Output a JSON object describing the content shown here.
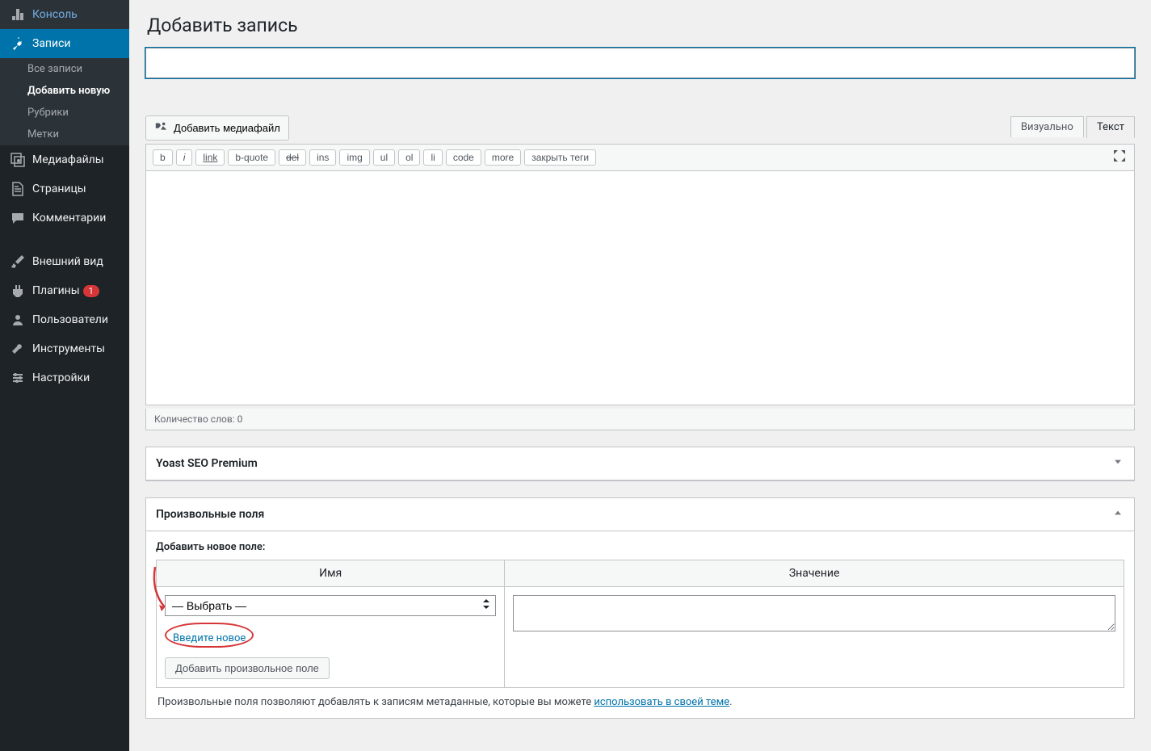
{
  "sidebar": {
    "items": [
      {
        "icon": "dashboard",
        "label": "Консоль"
      },
      {
        "icon": "pin",
        "label": "Записи",
        "active": true
      },
      {
        "icon": "media",
        "label": "Медиафайлы"
      },
      {
        "icon": "page",
        "label": "Страницы"
      },
      {
        "icon": "comment",
        "label": "Комментарии"
      },
      {
        "icon": "appearance",
        "label": "Внешний вид"
      },
      {
        "icon": "plugin",
        "label": "Плагины",
        "badge": "1"
      },
      {
        "icon": "users",
        "label": "Пользователи"
      },
      {
        "icon": "tools",
        "label": "Инструменты"
      },
      {
        "icon": "settings",
        "label": "Настройки"
      }
    ],
    "submenu": [
      "Все записи",
      "Добавить новую",
      "Рубрики",
      "Метки"
    ],
    "submenu_current": 1
  },
  "page": {
    "title": "Добавить запись",
    "title_placeholder": ""
  },
  "media_btn": "Добавить медиафайл",
  "tabs": {
    "visual": "Визуально",
    "text": "Текст"
  },
  "toolbar": [
    "b",
    "i",
    "link",
    "b-quote",
    "del",
    "ins",
    "img",
    "ul",
    "ol",
    "li",
    "code",
    "more",
    "закрыть теги"
  ],
  "wordcount": "Количество слов: 0",
  "metabox_yoast": "Yoast SEO Premium",
  "metabox_cf": {
    "title": "Произвольные поля",
    "add_label": "Добавить новое поле:",
    "th_name": "Имя",
    "th_value": "Значение",
    "select_placeholder": "— Выбрать —",
    "enter_new": "Введите новое",
    "add_btn": "Добавить произвольное поле",
    "desc_prefix": "Произвольные поля позволяют добавлять к записям метаданные, которые вы можете ",
    "desc_link": "использовать в своей теме",
    "desc_suffix": "."
  }
}
